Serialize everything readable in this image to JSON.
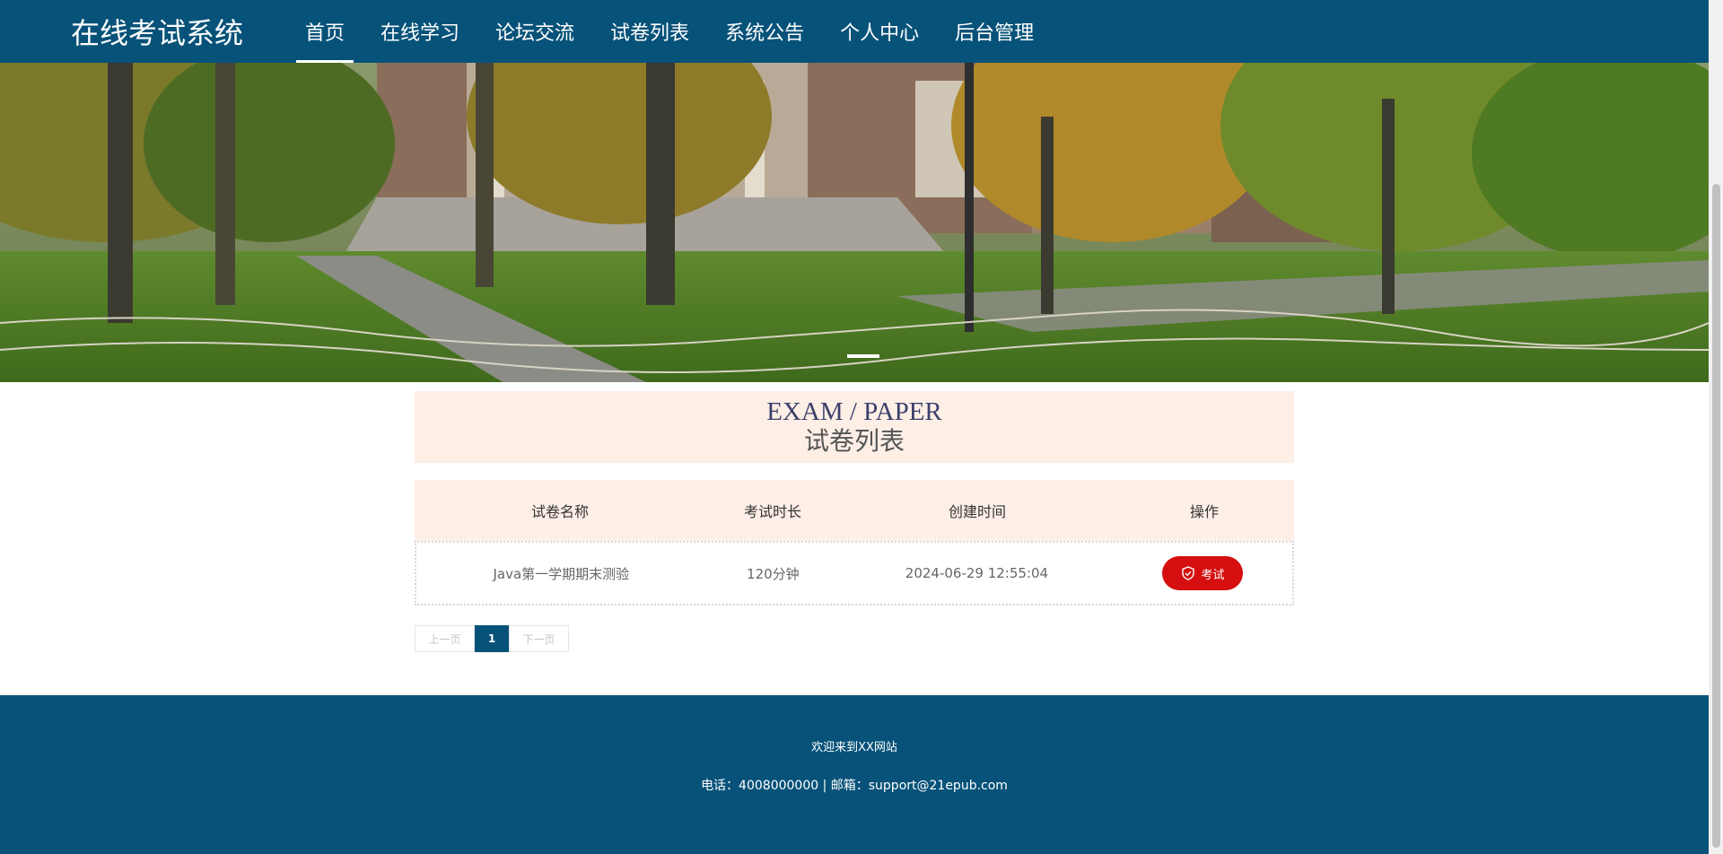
{
  "header": {
    "brand": "在线考试系统",
    "nav": [
      {
        "label": "首页",
        "active": true
      },
      {
        "label": "在线学习",
        "active": false
      },
      {
        "label": "论坛交流",
        "active": false
      },
      {
        "label": "试卷列表",
        "active": false
      },
      {
        "label": "系统公告",
        "active": false
      },
      {
        "label": "个人中心",
        "active": false
      },
      {
        "label": "后台管理",
        "active": false
      }
    ]
  },
  "section": {
    "title_en": "EXAM / PAPER",
    "title_cn": "试卷列表"
  },
  "table": {
    "headers": [
      "试卷名称",
      "考试时长",
      "创建时间",
      "操作"
    ],
    "rows": [
      {
        "name": "Java第一学期期末测验",
        "duration": "120分钟",
        "created": "2024-06-29 12:55:04",
        "action": "考试"
      }
    ]
  },
  "pagination": {
    "prev": "上一页",
    "current": "1",
    "next": "下一页"
  },
  "footer": {
    "line1": "欢迎来到XX网站",
    "line2": "电话：4008000000 | 邮箱：support@21epub.com"
  },
  "colors": {
    "primary": "#075279",
    "accent_red": "#d50f0f",
    "section_bg": "#fdeee6"
  },
  "icons": {
    "exam_button_icon": "shield-check-icon"
  }
}
